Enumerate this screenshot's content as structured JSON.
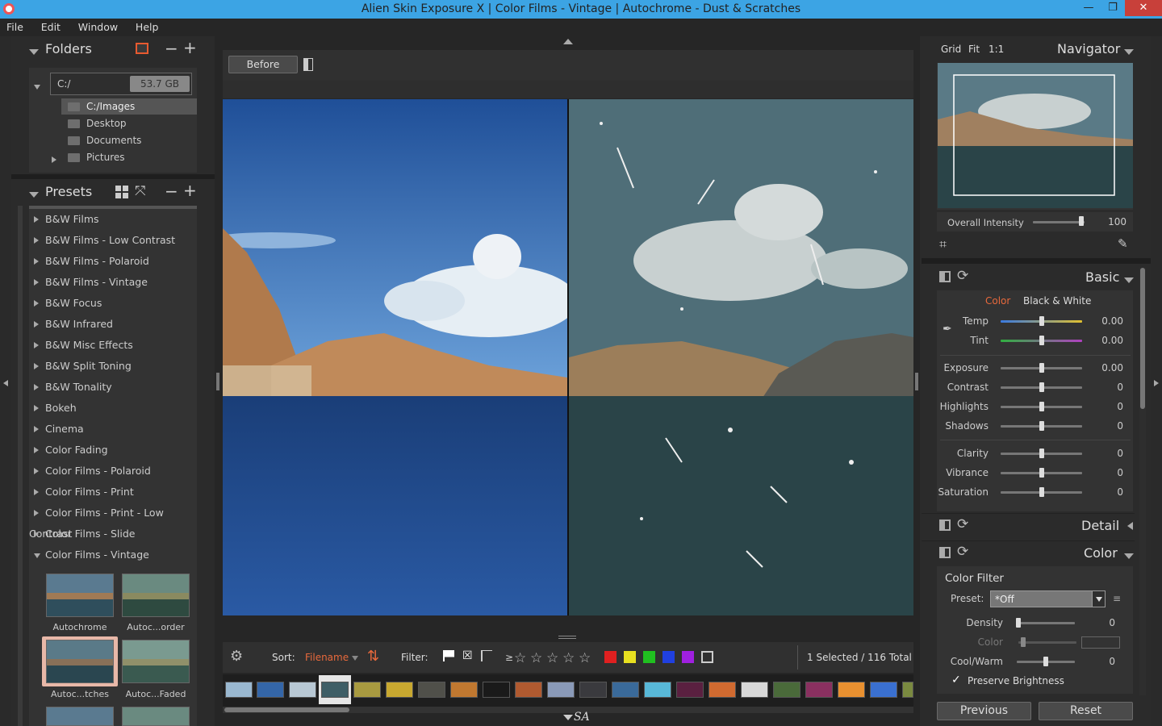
{
  "window": {
    "title": "Alien Skin Exposure X | Color Films - Vintage | Autochrome - Dust & Scratches"
  },
  "menu": [
    "File",
    "Edit",
    "Window",
    "Help"
  ],
  "folders": {
    "title": "Folders",
    "drive": "C:/",
    "drive_size": "53.7 GB",
    "items": [
      "C:/Images",
      "Desktop",
      "Documents",
      "Pictures"
    ]
  },
  "presets": {
    "title": "Presets",
    "items": [
      "B&W Films",
      "B&W Films - Low Contrast",
      "B&W Films - Polaroid",
      "B&W Films - Vintage",
      "B&W Focus",
      "B&W Infrared",
      "B&W Misc Effects",
      "B&W Split Toning",
      "B&W Tonality",
      "Bokeh",
      "Cinema",
      "Color Fading",
      "Color Films - Polaroid",
      "Color Films - Print",
      "Color Films - Print - Low Contrast",
      "Color Films - Slide",
      "Color Films - Vintage"
    ],
    "thumbs": [
      "Autochrome",
      "Autoc...order",
      "Autoc...tches",
      "Autoc...Faded"
    ]
  },
  "viewer": {
    "before_label": "Before"
  },
  "toolbar": {
    "sort_label": "Sort:",
    "sort_value": "Filename",
    "filter_label": "Filter:",
    "gte": "≥",
    "stars": [
      "☆",
      "☆",
      "☆",
      "☆",
      "☆"
    ],
    "swatch_colors": [
      "#e02020",
      "#e8e020",
      "#20c020",
      "#2040e0",
      "#a020e0"
    ],
    "selection": "1 Selected / 116 Total",
    "logo": "SA"
  },
  "navigator": {
    "grid": "Grid",
    "fit": "Fit",
    "one": "1:1",
    "title": "Navigator",
    "intensity_label": "Overall Intensity",
    "intensity_value": "100",
    "intensity_level": 100
  },
  "basic": {
    "title": "Basic",
    "mode_color": "Color",
    "mode_bw": "Black & White",
    "accent": "#e8693c",
    "rows": [
      {
        "label": "Temp",
        "value": "0.00",
        "level": 0.5
      },
      {
        "label": "Tint",
        "value": "0.00",
        "level": 0.5
      },
      {
        "label": "Exposure",
        "value": "0.00",
        "level": 0.5
      },
      {
        "label": "Contrast",
        "value": "0",
        "level": 0.5
      },
      {
        "label": "Highlights",
        "value": "0",
        "level": 0.5
      },
      {
        "label": "Shadows",
        "value": "0",
        "level": 0.5
      },
      {
        "label": "Clarity",
        "value": "0",
        "level": 0.5
      },
      {
        "label": "Vibrance",
        "value": "0",
        "level": 0.5
      },
      {
        "label": "Saturation",
        "value": "0",
        "level": 0.5
      }
    ]
  },
  "detail": {
    "title": "Detail"
  },
  "color": {
    "title": "Color",
    "filter_title": "Color Filter",
    "preset_label": "Preset:",
    "preset_value": "*Off",
    "density_label": "Density",
    "density_value": "0",
    "color_label": "Color",
    "coolwarm_label": "Cool/Warm",
    "coolwarm_value": "0",
    "preserve_label": "Preserve Brightness",
    "preserve_checked": true
  },
  "buttons": {
    "previous": "Previous",
    "reset": "Reset"
  }
}
